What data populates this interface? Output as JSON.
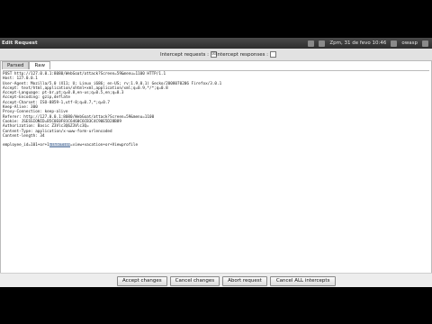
{
  "panel": {
    "window_title": "Edit Request",
    "clock": "Zpm, 31 de fevo 10:46",
    "user": "owasp"
  },
  "intercept": {
    "requests_label": "Intercept requests :",
    "requests_checked": "☒",
    "responses_label": "Intercept responses :",
    "responses_checked": ""
  },
  "tabs": [
    "Parsed",
    "Raw"
  ],
  "active_tab": "Raw",
  "editor": {
    "lines": [
      "POST http://127.0.0.1:8080/WebGoat/attack?Screen=59&menu=1100 HTTP/1.1",
      "Host: 127.0.0.1",
      "User-Agent: Mozilla/5.0 (X11; U; Linux i686; en-US; rv:1.9.0.1) Gecko/2008070206 Firefox/3.0.1",
      "Accept: text/html,application/xhtml+xml,application/xml;q=0.9,*/*;q=0.8",
      "Accept-Language: pt-br,pt;q=0.8,en-us;q=0.5,en;q=0.3",
      "Accept-Encoding: gzip,deflate",
      "Accept-Charset: ISO-8859-1,utf-8;q=0.7,*;q=0.7",
      "Keep-Alive: 300",
      "Proxy-Connection: keep-alive",
      "Referer: http://127.0.0.1:8080/WebGoat/attack?Screen=59&menu=1100",
      "Cookie: JSESSIONID=B5C0E0F81C6460C6CB3C4C90E5D28B89",
      "Authorization: Basic Z3Vlc3Q6Z3Vlc3Q=",
      "Content-Type: application/x-www-form-urlencoded",
      "Content-length: 34",
      "",
      "employee_id=101&action=ViewProfile"
    ],
    "body_prefix": "employee_id=101+or+1",
    "body_highlight": "=1&action",
    "body_suffix": "=view+vacation+or+Viewprofile"
  },
  "footer": {
    "accept": "Accept changes",
    "cancel": "Cancel changes",
    "abort": "Abort request",
    "cancel_all": "Cancel ALL intercepts"
  }
}
